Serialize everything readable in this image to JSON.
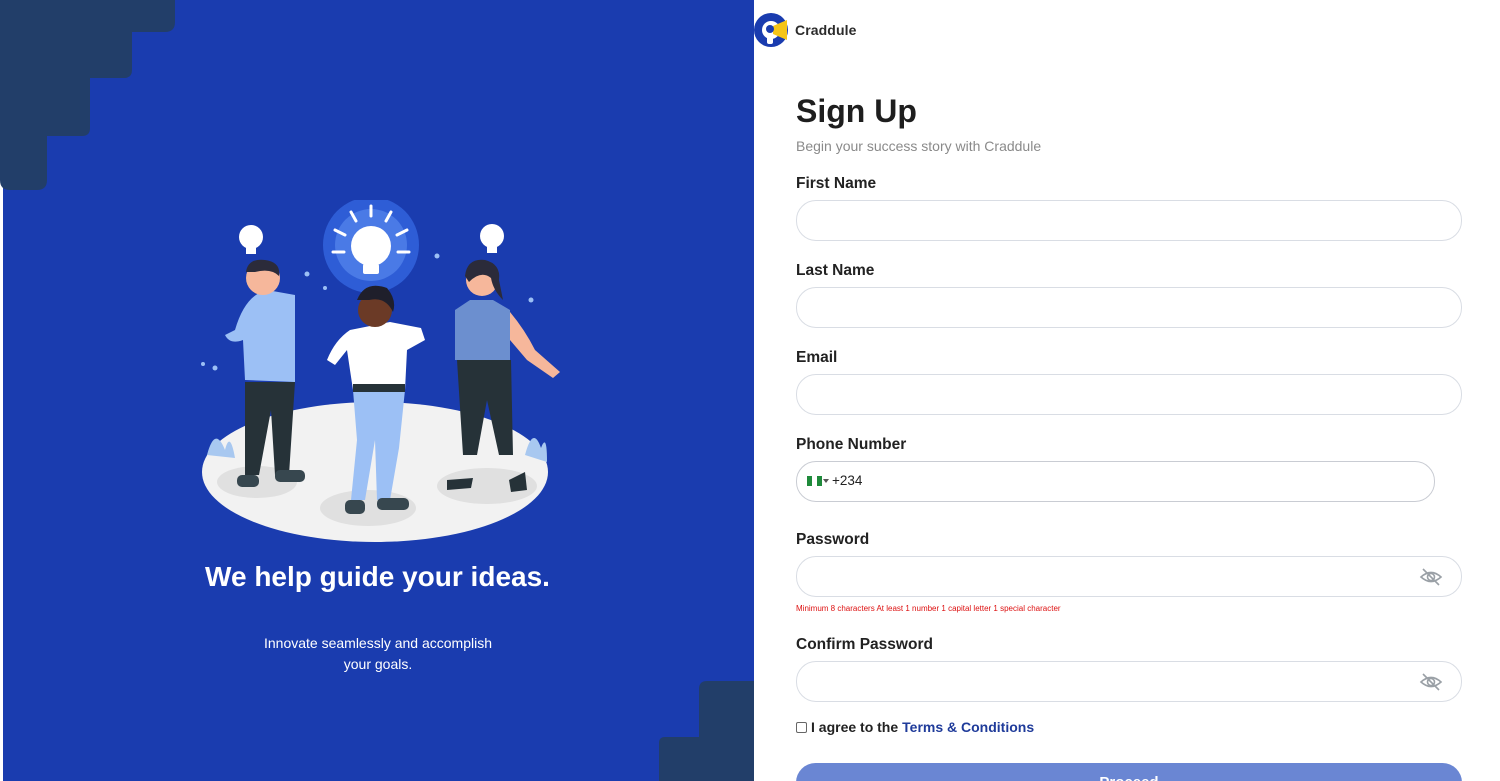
{
  "brand": {
    "name": "Craddule",
    "accent": "#1a3caf",
    "logo_yellow": "#f5c518"
  },
  "hero": {
    "title": "We help guide your ideas.",
    "subtitle": "Innovate seamlessly and accomplish your goals."
  },
  "form": {
    "title": "Sign Up",
    "subtitle": "Begin your success story with Craddule",
    "fields": [
      {
        "label": "First Name",
        "value": ""
      },
      {
        "label": "Last Name",
        "value": ""
      },
      {
        "label": "Email",
        "value": ""
      }
    ],
    "phone": {
      "label": "Phone Number",
      "country": "NG",
      "dial_code": "+234",
      "value": ""
    },
    "password": {
      "label": "Password",
      "value": "",
      "hint": "Minimum 8 characters At least 1 number 1 capital letter 1 special character",
      "toggle_icon": "eye-off-icon"
    },
    "confirm_password": {
      "label": "Confirm Password",
      "value": "",
      "toggle_icon": "eye-off-icon"
    },
    "terms": {
      "prefix": "I agree to the",
      "link": "Terms & Conditions",
      "checked": false
    },
    "submit_label": "Proceed"
  },
  "colors": {
    "panel": "#1a3caf",
    "steps": "#223e69",
    "button": "#6a86d3",
    "hint": "#dd1111",
    "link": "#1f3b9a"
  }
}
